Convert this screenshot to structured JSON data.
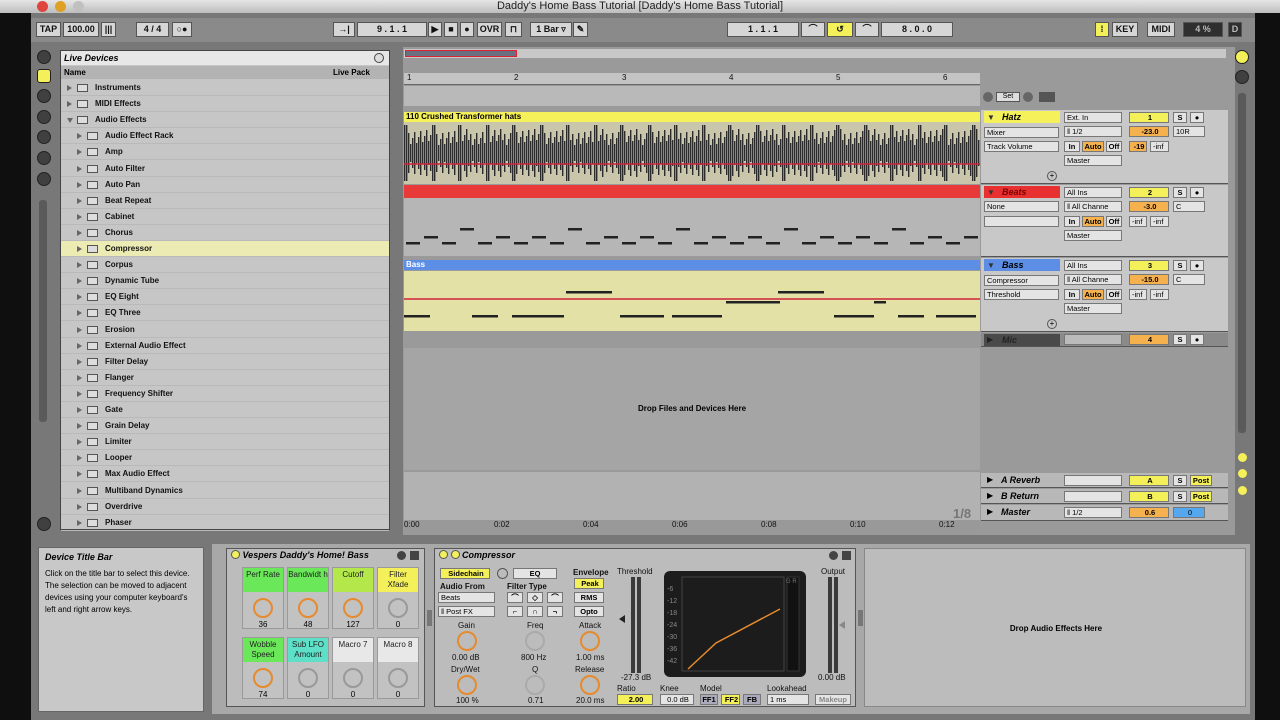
{
  "window": {
    "title": "Daddy's Home Bass Tutorial  [Daddy's Home Bass Tutorial]"
  },
  "transport": {
    "tap": "TAP",
    "tempo": "100.00",
    "meter_icon": "|||",
    "signature": "4 / 4",
    "metro": "○●",
    "follow": "→|",
    "position": "9 . 1 . 1",
    "ovr": "OVR",
    "quantize": "1 Bar ▿",
    "loop_start": "1 . 1 . 1",
    "loop_len": "8 . 0 . 0",
    "key": "KEY",
    "midi": "MIDI",
    "cpu": "4 %",
    "d": "D"
  },
  "browser": {
    "title": "Live Devices",
    "col_name": "Name",
    "col_pack": "Live Pack",
    "top_items": [
      "Instruments",
      "MIDI Effects",
      "Audio Effects"
    ],
    "effects": [
      "Audio Effect Rack",
      "Amp",
      "Auto Filter",
      "Auto Pan",
      "Beat Repeat",
      "Cabinet",
      "Chorus",
      "Compressor",
      "Corpus",
      "Dynamic Tube",
      "EQ Eight",
      "EQ Three",
      "Erosion",
      "External Audio Effect",
      "Filter Delay",
      "Flanger",
      "Frequency Shifter",
      "Gate",
      "Grain Delay",
      "Limiter",
      "Looper",
      "Max Audio Effect",
      "Multiband Dynamics",
      "Overdrive",
      "Phaser"
    ],
    "selected": "Compressor"
  },
  "arrangement": {
    "ruler": [
      "1",
      "2",
      "3",
      "4",
      "5",
      "6"
    ],
    "time_ruler": [
      "0:00",
      "0:02",
      "0:04",
      "0:06",
      "0:08",
      "0:10",
      "0:12"
    ],
    "clips": {
      "hatz": "110 Crushed Transformer hats",
      "bass": "Bass"
    },
    "drop_text": "Drop Files and Devices Here",
    "grid": "1/8",
    "set_label": "Set"
  },
  "tracks": [
    {
      "name": "Hatz",
      "color": "#f5f15a",
      "in": "Ext. In",
      "chan": "ǁ 1/2",
      "dev": "Mixer",
      "param": "Track Volume",
      "out": "Master",
      "num": "1",
      "vol": "-23.0",
      "pan": "10R",
      "peak": "-19",
      "peak2": "-inf"
    },
    {
      "name": "Beats",
      "color": "#e83030",
      "in": "All Ins",
      "chan": "ǁ All Channe",
      "dev": "None",
      "param": "",
      "out": "Master",
      "num": "2",
      "vol": "-3.0",
      "pan": "C",
      "peak": "-inf",
      "peak2": "-inf"
    },
    {
      "name": "Bass",
      "color": "#5c8ee6",
      "in": "All Ins",
      "chan": "ǁ All Channe",
      "dev": "Compressor",
      "param": "Threshold",
      "out": "Master",
      "num": "3",
      "vol": "-15.0",
      "pan": "C",
      "peak": "-inf",
      "peak2": "-inf"
    },
    {
      "name": "Mic",
      "color": "#444444",
      "num": "4"
    }
  ],
  "track_buttons": {
    "in": "In",
    "auto": "Auto",
    "off": "Off",
    "solo": "S"
  },
  "returns": [
    {
      "name": "A Reverb",
      "num": "A",
      "post": "Post"
    },
    {
      "name": "B Return",
      "num": "B",
      "post": "Post"
    },
    {
      "name": "Master",
      "num": "0.6",
      "chan": "ǁ 1/2",
      "val": "0"
    }
  ],
  "info": {
    "title": "Device Title Bar",
    "text": "Click on the title bar to select this device. The selection can be moved to adjacent devices using your computer keyboard's left and right arrow keys."
  },
  "rack": {
    "title": "Vespers Daddy's Home! Bass",
    "macros": [
      {
        "label": "Perf Rate",
        "value": "36",
        "color": "#6be85a"
      },
      {
        "label": "Bandwidt h",
        "value": "48",
        "color": "#6be85a"
      },
      {
        "label": "Cutoff",
        "value": "127",
        "color": "#b4e84a"
      },
      {
        "label": "Filter Xfade",
        "value": "0",
        "color": "#f3f05a"
      },
      {
        "label": "Wobble Speed",
        "value": "74",
        "color": "#6be85a"
      },
      {
        "label": "Sub LFO Amount",
        "value": "0",
        "color": "#5ee0c8"
      },
      {
        "label": "Macro 7",
        "value": "0",
        "color": "#e8e8e8"
      },
      {
        "label": "Macro 8",
        "value": "0",
        "color": "#e8e8e8"
      }
    ]
  },
  "compressor": {
    "title": "Compressor",
    "sidechain": "Sidechain",
    "eq": "EQ",
    "audio_from": "Audio From",
    "source": "Beats",
    "tap": "ǁ Post FX",
    "gain_label": "Gain",
    "gain": "0.00 dB",
    "drywet_label": "Dry/Wet",
    "drywet": "100 %",
    "filter_type": "Filter Type",
    "freq_label": "Freq",
    "freq": "800 Hz",
    "q_label": "Q",
    "q": "0.71",
    "envelope": "Envelope",
    "peak": "Peak",
    "rms": "RMS",
    "opto": "Opto",
    "attack_label": "Attack",
    "attack": "1.00 ms",
    "release_label": "Release",
    "release": "20.0 ms",
    "threshold_label": "Threshold",
    "threshold": "-27.3 dB",
    "graph_ticks": [
      "-6",
      "-12",
      "-18",
      "-24",
      "-30",
      "-36",
      "-42"
    ],
    "gr": "G R",
    "output_label": "Output",
    "output": "0.00 dB",
    "ratio_label": "Ratio",
    "ratio": "2.00",
    "knee_label": "Knee",
    "knee": "0.0 dB",
    "model_label": "Model",
    "ff1": "FF1",
    "ff2": "FF2",
    "fb": "FB",
    "lookahead_label": "Lookahead",
    "lookahead": "1 ms",
    "makeup": "Makeup"
  },
  "drop_fx": "Drop Audio Effects Here"
}
